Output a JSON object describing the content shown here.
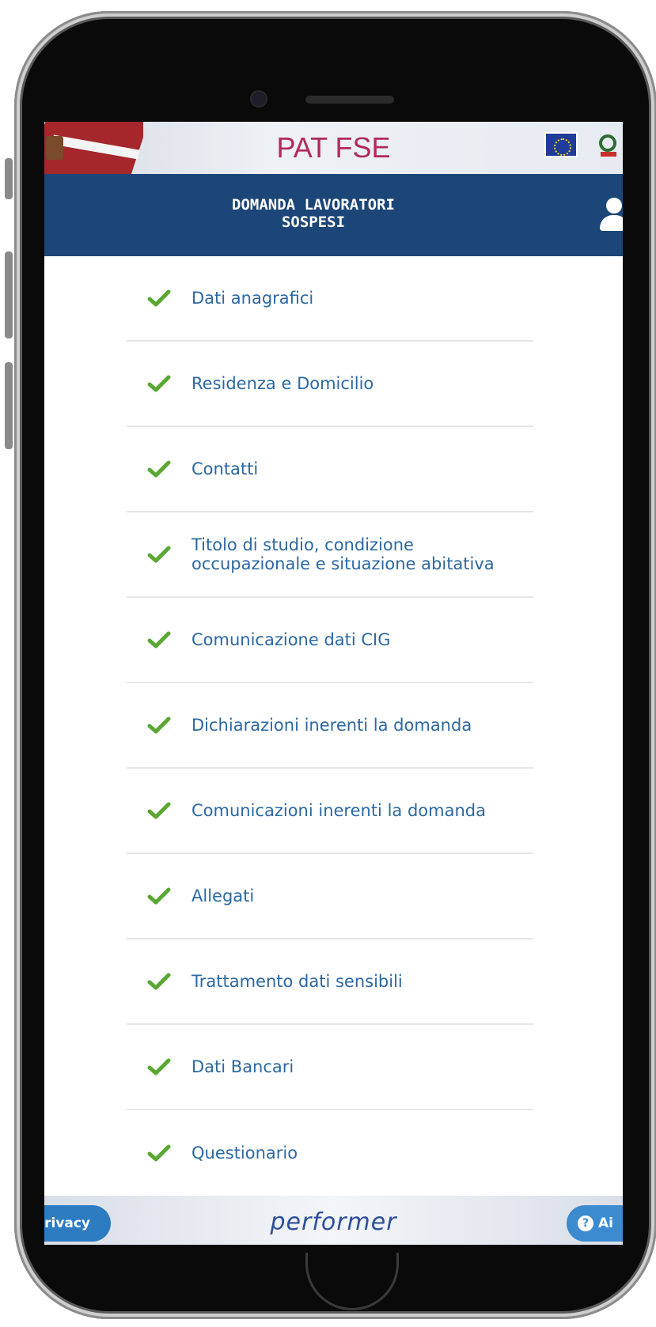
{
  "topbar": {
    "app_title": "PAT FSE",
    "eu_logo": "eu-flag-icon",
    "republic_emblem": "italian-emblem-icon",
    "regional_flag": "trentino-flag-icon"
  },
  "header": {
    "title_line1": "DOMANDA LAVORATORI",
    "title_line2": "SOSPESI",
    "user_icon": "user-icon"
  },
  "sections": [
    {
      "label": "Dati anagrafici",
      "status": "completed"
    },
    {
      "label": "Residenza e Domicilio",
      "status": "completed"
    },
    {
      "label": "Contatti",
      "status": "completed"
    },
    {
      "label": "Titolo di studio, condizione occupazionale e situazione abitativa",
      "status": "completed"
    },
    {
      "label": "Comunicazione dati CIG",
      "status": "completed"
    },
    {
      "label": "Dichiarazioni inerenti la domanda",
      "status": "completed"
    },
    {
      "label": "Comunicazioni inerenti la domanda",
      "status": "completed"
    },
    {
      "label": "Allegati",
      "status": "completed"
    },
    {
      "label": "Trattamento dati sensibili",
      "status": "completed"
    },
    {
      "label": "Dati Bancari",
      "status": "completed"
    },
    {
      "label": "Questionario",
      "status": "completed"
    }
  ],
  "colors": {
    "header_bg": "#1b4677",
    "title_color": "#b22a5d",
    "link_color": "#2b68a3",
    "check_color": "#5aa832",
    "button_bg": "#2d7cc1"
  },
  "footer": {
    "privacy_label": "rivacy",
    "brand": "performer",
    "help_label": "Ai"
  }
}
